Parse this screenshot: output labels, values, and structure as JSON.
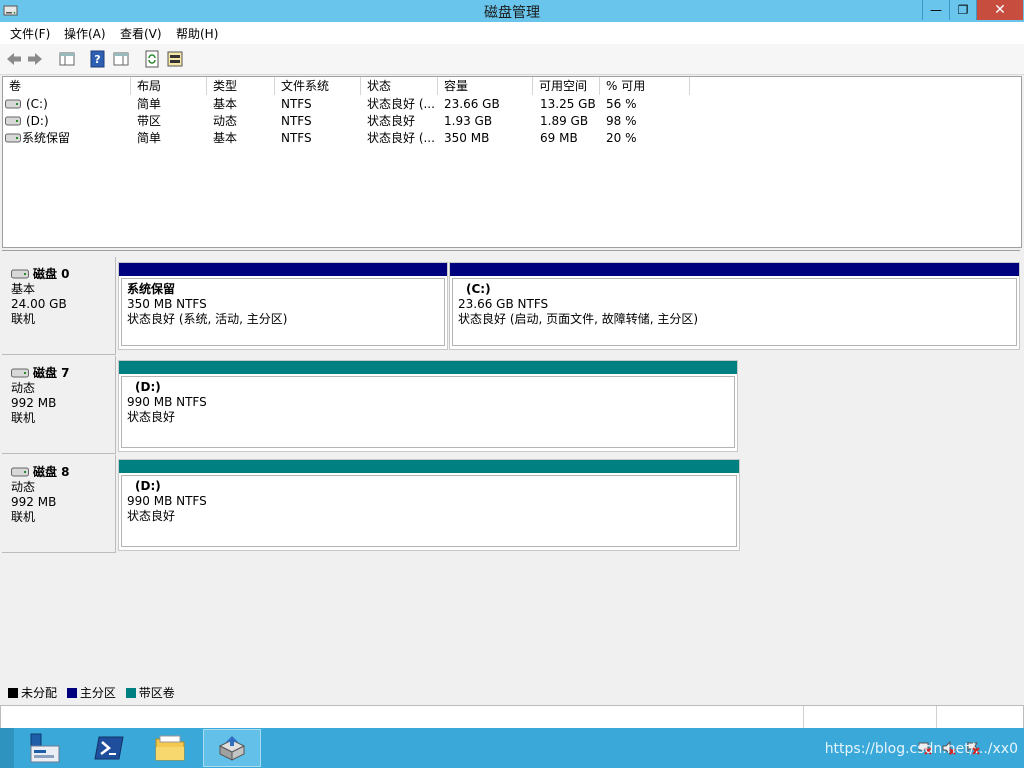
{
  "window": {
    "title": "磁盘管理",
    "min": "—",
    "restore": "❐",
    "close": "✕"
  },
  "menu": [
    "文件(F)",
    "操作(A)",
    "查看(V)",
    "帮助(H)"
  ],
  "volume_list": {
    "columns": [
      "卷",
      "布局",
      "类型",
      "文件系统",
      "状态",
      "容量",
      "可用空间",
      "% 可用"
    ],
    "rows": [
      [
        "(C:)",
        "简单",
        "基本",
        "NTFS",
        "状态良好 (...",
        "23.66 GB",
        "13.25 GB",
        "56 %"
      ],
      [
        "(D:)",
        "带区",
        "动态",
        "NTFS",
        "状态良好",
        "1.93 GB",
        "1.89 GB",
        "98 %"
      ],
      [
        "系统保留",
        "简单",
        "基本",
        "NTFS",
        "状态良好 (...",
        "350 MB",
        "69 MB",
        "20 %"
      ]
    ]
  },
  "disks": [
    {
      "name": "磁盘 0",
      "type": "基本",
      "size": "24.00 GB",
      "status": "联机",
      "partitions": [
        {
          "label": "系统保留",
          "size": "350 MB NTFS",
          "status": "状态良好 (系统, 活动, 主分区)",
          "kind": "primary"
        },
        {
          "label": "(C:)",
          "size": "23.66 GB NTFS",
          "status": "状态良好 (启动, 页面文件, 故障转储, 主分区)",
          "kind": "primary"
        }
      ]
    },
    {
      "name": "磁盘 7",
      "type": "动态",
      "size": "992 MB",
      "status": "联机",
      "partitions": [
        {
          "label": "(D:)",
          "size": "990 MB NTFS",
          "status": "状态良好",
          "kind": "striped"
        }
      ]
    },
    {
      "name": "磁盘 8",
      "type": "动态",
      "size": "992 MB",
      "status": "联机",
      "partitions": [
        {
          "label": "(D:)",
          "size": "990 MB NTFS",
          "status": "状态良好",
          "kind": "striped"
        }
      ]
    }
  ],
  "legend": [
    {
      "label": "未分配",
      "color": "#000000"
    },
    {
      "label": "主分区",
      "color": "#00007f"
    },
    {
      "label": "带区卷",
      "color": "#008080"
    }
  ],
  "colors": {
    "primary": "#00007f",
    "striped": "#008080",
    "titlebar": "#6ac5ec",
    "taskbar": "#3aa9d9"
  },
  "taskbar": {
    "apps": [
      "server-manager-icon",
      "powershell-icon",
      "file-explorer-icon",
      "disk-management-icon"
    ],
    "watermark": "https://blog.csdn.net/.../xx0"
  }
}
